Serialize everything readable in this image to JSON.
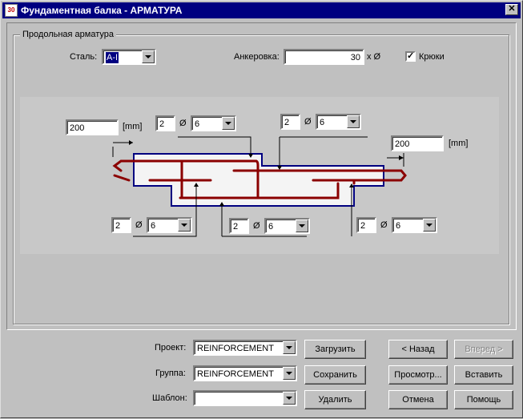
{
  "window": {
    "title": "Фундаментная балка - АРМАТУРА",
    "app_icon_text": "30",
    "close_glyph": "✕"
  },
  "group": {
    "title": "Продольная арматура"
  },
  "top_row": {
    "steel_label": "Сталь:",
    "steel_value": "A-I",
    "anchorage_label": "Анкеровка:",
    "anchorage_value": "30",
    "anchorage_suffix": "x Ø",
    "hooks_label": "Крюки",
    "hooks_checked": "✓"
  },
  "drawing": {
    "left_length": "200",
    "left_unit": "[mm]",
    "right_length": "200",
    "right_unit": "[mm]",
    "bars": [
      {
        "count": "2",
        "symbol": "Ø",
        "diameter": "6"
      },
      {
        "count": "2",
        "symbol": "Ø",
        "diameter": "6"
      },
      {
        "count": "2",
        "symbol": "Ø",
        "diameter": "6"
      },
      {
        "count": "2",
        "symbol": "Ø",
        "diameter": "6"
      },
      {
        "count": "2",
        "symbol": "Ø",
        "diameter": "6"
      }
    ],
    "colors": {
      "outline": "#000080",
      "rebar": "#8b0000",
      "background": "#c8c8c8"
    }
  },
  "bottom": {
    "project_label": "Проект:",
    "project_value": "REINFORCEMENT",
    "group_label": "Группа:",
    "group_value": "REINFORCEMENT",
    "template_label": "Шаблон:",
    "template_value": "",
    "load_button": "Загрузить",
    "save_button": "Сохранить",
    "delete_button": "Удалить",
    "back_button": "< Назад",
    "forward_button": "Вперед >",
    "preview_button": "Просмотр...",
    "insert_button": "Вставить",
    "cancel_button": "Отмена",
    "help_button": "Помощь"
  }
}
